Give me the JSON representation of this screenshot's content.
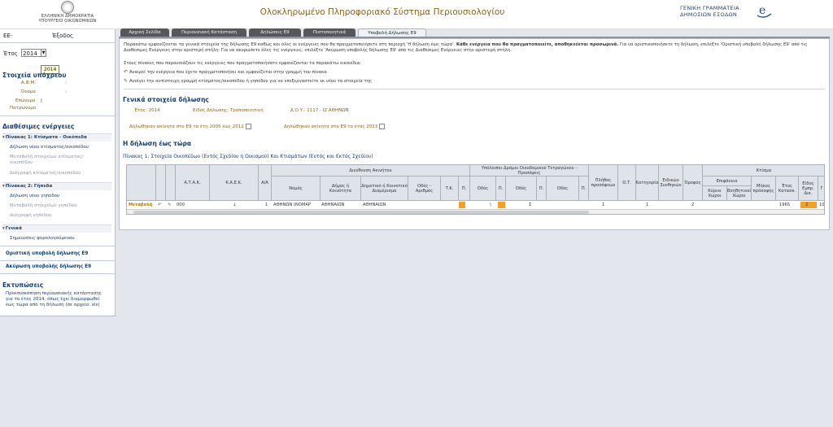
{
  "header": {
    "emblem_line1": "ΕΛΛΗΝΙΚΗ ΔΗΜΟΚΡΑΤΙΑ",
    "emblem_line2": "ΥΠΟΥΡΓΕΙΟ ΟΙΚΟΝΟΜΙΚΩΝ",
    "app_title": "Ολοκληρωμένο Πληροφοριακό Σύστημα Περιουσιολογίου",
    "gsis_line1": "ΓΕΝΙΚΗ ΓΡΑΜΜΑΤΕΙΑ",
    "gsis_line2": "ΔΗΜΟΣΙΩΝ ΕΣΟΔΩΝ",
    "gsis_logo_letter": "e"
  },
  "sidebar": {
    "user_prefix": "ΕΕ-",
    "exit_label": "Έξοδος",
    "year_label": "Έτος",
    "year_value": "2014",
    "year_tooltip": "2014",
    "taxpayer_heading": "Στοιχεία υπόχρεου",
    "fields": [
      {
        "label": "Α.Φ.Μ.",
        "value": ":"
      },
      {
        "label": "Όνομα",
        "value": ":"
      },
      {
        "label": "Επώνυμο",
        "value": "|"
      },
      {
        "label": "Πατρώνυμο",
        "value": ""
      }
    ],
    "actions_heading": "Διαθέσιμες ενέργειες",
    "groups": [
      {
        "label": "Πίνακας 1: Κτίσματα - Οικόπεδα",
        "links": [
          {
            "label": "Δήλωση νέου κτίσματος/οικοπέδου",
            "enabled": true
          },
          {
            "label": "Μεταβολή στοιχείων κτίσματος/οικοπέδου",
            "enabled": false
          },
          {
            "label": "Διαγραφή κτίσματος/οικοπέδου",
            "enabled": false
          }
        ]
      },
      {
        "label": "Πίνακας 2: Γήπεδα",
        "links": [
          {
            "label": "Δήλωση νέου γηπέδου",
            "enabled": true
          },
          {
            "label": "Μεταβολή στοιχείων γηπέδου",
            "enabled": false
          },
          {
            "label": "Διαγραφή γηπέδου",
            "enabled": false
          }
        ]
      },
      {
        "label": "Γενικά",
        "links": [
          {
            "label": "Σημειώσεις φορολογούμενου",
            "enabled": true
          }
        ]
      }
    ],
    "final_submit": "Οριστική υποβολή δήλωσης Ε9",
    "cancel_submit": "Ακύρωση υποβολής δήλωσης Ε9",
    "prints_heading": "Εκτυπώσεις",
    "print_text": "Προεπισκόπηση περιουσιακής κατάστασης για το έτος 2014, όπως έχει διαμορφωθεί έως τώρα από τη δήλωση (σε αρχείο .xls)"
  },
  "tabs": [
    {
      "label": "Αρχική Σελίδα",
      "active": false
    },
    {
      "label": "Περιουσιακή Κατάσταση",
      "active": false
    },
    {
      "label": "Δηλώσεις Ε9",
      "active": false
    },
    {
      "label": "Πιστοποιητικά",
      "active": false
    },
    {
      "label": "Υποβολή Δήλωσης Ε9",
      "active": true
    }
  ],
  "main": {
    "intro_a": "Παρακάτω εμφανίζονται τα γενικά στοιχεία της δήλωσης Ε9 καθώς και όλες οι ενέργειες που θα πραγματοποιήσετε στη περιοχή 'Η δήλωση έως τώρα'.",
    "intro_b": "Κάθε ενέργεια που θα πραγματοποιείτε, αποθηκεύεται προσωρινά.",
    "intro_c": "Για να οριστικοποιήσετε τη δήλωση, επιλέξτε 'Οριστική υποβολή δήλωσης Ε9' από τις Διαθέσιμες Ενέργειες στην αριστερή στήλη. Για να ακυρώσετε όλες τις ενέργειες, επιλέξτε 'Ακύρωση υποβολής δήλωσης Ε9' από τις Διαθέσιμες Ενέργειες στην αριστερή στήλη.",
    "intro2": "Στους πίνακες που παρουσιάζουν τις ενέργειες που πραγματοποιήσατε εμφανίζονται τα παρακάτω εικονίδια:",
    "icon_help_undo": "Αναιρεί την ενέργεια που έχετε πραγματοποιήσει και εμφανίζεται στην γραμμή του πίνακα",
    "icon_help_edit": "Ανοίγει την αντίστοιχη γραμμή κτίσματος/οικοπέδου ή γηπέδου για να επεξεργαστείτε εκ νέου τα στοιχεία της",
    "general_heading": "Γενικά στοιχεία δήλωσης",
    "year_text": "Έτος: 2014",
    "type_text": "Είδος Δήλωσης: Τροποποιητική",
    "doy_text": "Δ.Ο.Υ.: 1117 - ΙΖ ΑΘΗΝΩΝ",
    "chk1_label": "Δηλώθηκαν ακίνητα στο Ε9 τα έτη 2005 έως 2012",
    "chk2_label": "Δηλώθηκαν ακίνητα στο Ε9 το έτος 2013",
    "declaration_heading": "Η δήλωση έως τώρα",
    "table_title": "Πίνακας 1: Στοιχεία Οικοπέδων (Εντός Σχεδίου ή Οικισμού) Και Κτισμάτων (Εντός και Εκτός Σχεδίου)",
    "table": {
      "headers": {
        "atak": "Α.Τ.Α.Κ.",
        "kaek": "Κ.Α.Ε.Κ.",
        "aa": "Α/Α",
        "address": "Διεύθυνση Ακινήτου",
        "nomos": "Νομός",
        "dimos": "Δήμος ή Κοινότητα",
        "diamerisma": "Δημοτικό ή Κοινοτικό Διαμέρισμα",
        "odos_arithmos": "Οδός - Αριθμός",
        "tk": "Τ.Κ.",
        "p": "Π.",
        "other_roads": "Υπόλοιποι Δρόμοι Οικοδομικού Τετραγώνου - Προσόψεις",
        "odos": "Οδός",
        "plithos": "Πλήθος προσόψεων",
        "ot": "Ο.Τ.",
        "katigoria": "Κατηγορία",
        "eidikes": "Ειδικών Συνθηκών",
        "orofos": "Όροφος",
        "ktisma": "Κτίσμα",
        "epifaneia": "Επιφάνεια",
        "kyrioi": "Κύριοι Χώροι",
        "voithitikoi": "Βοηθητικοί Χώροι",
        "mikos": "Μήκος πρόσοψης",
        "etos": "Έτος Κατασκ.",
        "eidos": "Είδος Εμπρ. Δικ.",
        "g": "Γ"
      },
      "row": {
        "action": "Μεταβολή",
        "atak": "000",
        "kaek": "↓",
        "aa": "1",
        "nomos": "ΑΘΗΝΩΝ (ΝΟΜΑΡ",
        "dimos": "ΑΘΗΝΑΙΩΝ",
        "diamerisma": "ΑΘΗΝΑΙΩΝ",
        "odos1": "\\",
        "odos2": "Σ",
        "plithos": "1",
        "katigoria": "1",
        "orofos": "2",
        "etos": "1965",
        "eidos": "2",
        "g": "10"
      }
    }
  }
}
